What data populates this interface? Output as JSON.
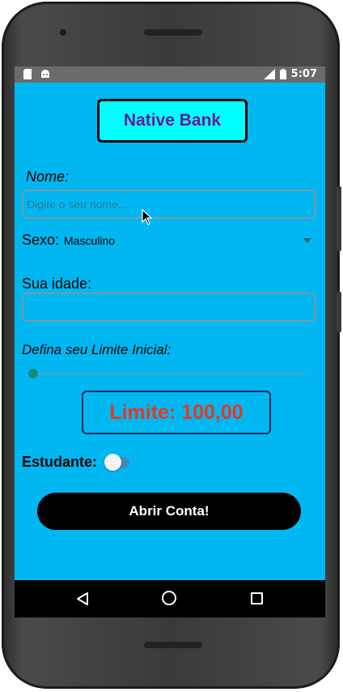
{
  "status_bar": {
    "time": "5:07",
    "icons": [
      "sd-card-icon",
      "android-icon",
      "lte-signal-icon",
      "battery-icon"
    ]
  },
  "app": {
    "title": "Native Bank"
  },
  "form": {
    "name_label": "Nome:",
    "name_placeholder": "Digite o seu nome...",
    "name_value": "",
    "sex_label": "Sexo:",
    "sex_selected": "Masculino",
    "age_label": "Sua idade:",
    "age_value": "",
    "limit_label": "Defina seu Limite Inicial:",
    "limit_slider_fraction": 0.0,
    "limit_display": "Limite: 100,00",
    "student_label": "Estudante:",
    "student_on": false,
    "submit_label": "Abrir Conta!"
  },
  "nav_bar": {
    "buttons": [
      "back",
      "home",
      "recents"
    ]
  },
  "colors": {
    "screen_bg": "#00b7f1",
    "title_bg": "#00ffff",
    "title_text": "#6a1b9a",
    "limit_text": "#e8371f",
    "button_bg": "#000000"
  }
}
